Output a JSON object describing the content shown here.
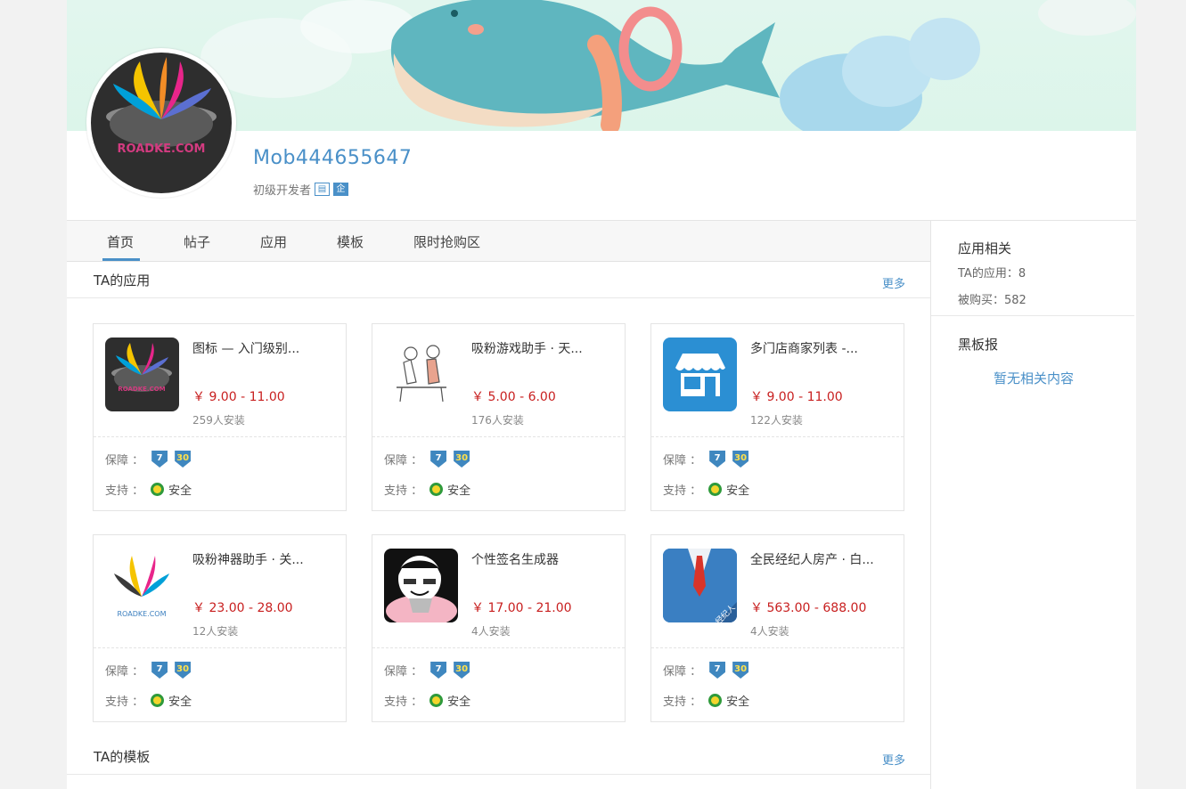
{
  "profile": {
    "username": "Mob444655647",
    "level": "初级开发者",
    "badge_1": "▤",
    "badge_2": "企"
  },
  "tabs": [
    {
      "label": "首页",
      "active": true
    },
    {
      "label": "帖子",
      "active": false
    },
    {
      "label": "应用",
      "active": false
    },
    {
      "label": "模板",
      "active": false
    },
    {
      "label": "限时抢购区",
      "active": false
    }
  ],
  "apps_section": {
    "title": "TA的应用",
    "more": "更多"
  },
  "templates_section": {
    "title": "TA的模板",
    "more": "更多"
  },
  "card_labels": {
    "guarantee": "保障 ：",
    "support": "支持 ：",
    "safe": "安全",
    "badge_7": "7",
    "badge_30": "30"
  },
  "apps": [
    {
      "name": "图标 — 入门级别...",
      "price": "￥ 9.00 - 11.00",
      "installs": "259人安装",
      "icon": "roadke-logo-dark-icon"
    },
    {
      "name": "吸粉游戏助手 · 天...",
      "price": "￥ 5.00 - 6.00",
      "installs": "176人安装",
      "icon": "sketch-couple-icon"
    },
    {
      "name": "多门店商家列表 -...",
      "price": "￥ 9.00 - 11.00",
      "installs": "122人安装",
      "icon": "storefront-icon"
    },
    {
      "name": "吸粉神器助手 · 关...",
      "price": "￥ 23.00 - 28.00",
      "installs": "12人安装",
      "icon": "roadke-logo-light-icon"
    },
    {
      "name": "个性签名生成器",
      "price": "￥ 17.00 - 21.00",
      "installs": "4人安装",
      "icon": "cartoon-face-icon"
    },
    {
      "name": "全民经纪人房产 · 白...",
      "price": "￥ 563.00 - 688.00",
      "installs": "4人安装",
      "icon": "broker-suit-icon"
    }
  ],
  "sidebar": {
    "app_title": "应用相关",
    "app_count": "TA的应用：8",
    "purchased": "被购买：582",
    "board_title": "黑板报",
    "board_empty": "暂无相关内容"
  },
  "colors": {
    "accent": "#4a90c8",
    "price": "#c81f1f",
    "banner": "#dcf5ea"
  }
}
